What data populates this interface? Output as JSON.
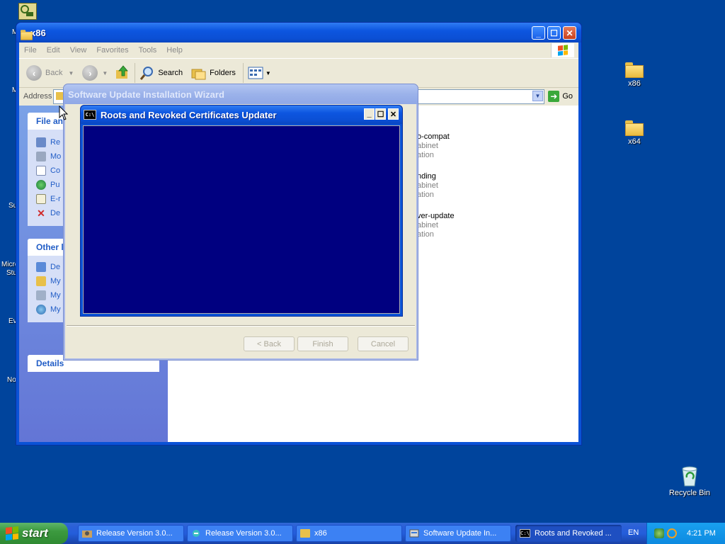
{
  "desktop": {
    "icons": [
      {
        "name": "x86",
        "type": "folder-icon"
      },
      {
        "name": "x64",
        "type": "folder-icon"
      },
      {
        "name": "Recycle Bin",
        "type": "recycle-bin-icon"
      }
    ],
    "left_clipped_labels": [
      "M",
      "M",
      "Su",
      "Micro",
      "Stu",
      "Ev",
      "No"
    ]
  },
  "explorer": {
    "title": "x86",
    "menu": [
      "File",
      "Edit",
      "View",
      "Favorites",
      "Tools",
      "Help"
    ],
    "toolbar": {
      "back": "Back",
      "search": "Search",
      "folders": "Folders"
    },
    "address_label": "Address",
    "go_label": "Go",
    "file_tasks": {
      "header": "File an",
      "items": [
        "Re",
        "Mo",
        "Co",
        "Pu",
        "E-r",
        "De"
      ]
    },
    "other_places": {
      "header": "Other l",
      "items": [
        "De",
        "My",
        "My",
        "My"
      ]
    },
    "details_header": "Details",
    "files": [
      {
        "name": "o-compat",
        "type": "abinet",
        "extra": "ation"
      },
      {
        "name": "nding",
        "type": "abinet",
        "extra": "ation"
      },
      {
        "name": "ver-update",
        "type": "abinet",
        "extra": "ation"
      }
    ]
  },
  "wizard": {
    "title": "Software Update Installation Wizard",
    "buttons": {
      "back": "< Back",
      "finish": "Finish",
      "cancel": "Cancel"
    }
  },
  "console": {
    "title": "Roots and Revoked Certificates Updater",
    "icon_text": "C:\\",
    "body_color": "#000080"
  },
  "taskbar": {
    "start_label": "start",
    "buttons": [
      {
        "label": "Release Version 3.0...",
        "active": false
      },
      {
        "label": "Release Version 3.0...",
        "active": false
      },
      {
        "label": "x86",
        "active": false
      },
      {
        "label": "Software Update In...",
        "active": false
      },
      {
        "label": "Roots and Revoked ...",
        "active": true
      }
    ],
    "language": "EN",
    "clock": "4:21 PM"
  }
}
